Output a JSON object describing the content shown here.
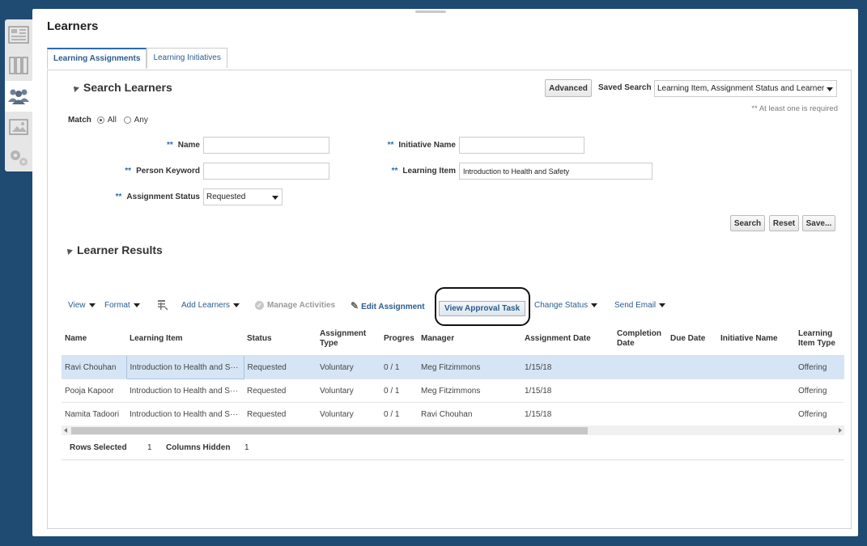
{
  "page": {
    "title": "Learners"
  },
  "tabs": [
    {
      "label": "Learning Assignments",
      "active": true
    },
    {
      "label": "Learning Initiatives",
      "active": false
    }
  ],
  "search": {
    "title": "Search Learners",
    "advanced_label": "Advanced",
    "saved_search_label": "Saved Search",
    "saved_search_value": "Learning Item, Assignment Status and Learner",
    "required_note": "** At least one is required",
    "match_label": "Match",
    "match_all": "All",
    "match_any": "Any",
    "required_marker": "**",
    "fields": {
      "name": {
        "label": "Name",
        "value": ""
      },
      "person_keyword": {
        "label": "Person Keyword",
        "value": ""
      },
      "assignment_status": {
        "label": "Assignment Status",
        "value": "Requested"
      },
      "initiative_name": {
        "label": "Initiative Name",
        "value": ""
      },
      "learning_item": {
        "label": "Learning Item",
        "value": "Introduction to Health and Safety"
      }
    },
    "buttons": {
      "search": "Search",
      "reset": "Reset",
      "save": "Save..."
    }
  },
  "results": {
    "title": "Learner Results",
    "toolbar": {
      "view": "View",
      "format": "Format",
      "add_learners": "Add Learners",
      "manage_activities": "Manage Activities",
      "edit_assignment": "Edit Assignment",
      "view_approval_task": "View Approval Task",
      "change_status": "Change Status",
      "send_email": "Send Email"
    },
    "columns": [
      "Name",
      "Learning Item",
      "Status",
      "Assignment Type",
      "Progres",
      "Manager",
      "Assignment Date",
      "Completion Date",
      "Due Date",
      "Initiative Name",
      "Learning Item Type"
    ],
    "rows": [
      [
        "Ravi Chouhan",
        "Introduction to Health and S···",
        "Requested",
        "Voluntary",
        "0 / 1",
        "Meg Fitzimmons",
        "1/15/18",
        "",
        "",
        "",
        "Offering"
      ],
      [
        "Pooja Kapoor",
        "Introduction to Health and S···",
        "Requested",
        "Voluntary",
        "0 / 1",
        "Meg Fitzimmons",
        "1/15/18",
        "",
        "",
        "",
        "Offering"
      ],
      [
        "Namita Tadoori",
        "Introduction to Health and S···",
        "Requested",
        "Voluntary",
        "0 / 1",
        "Ravi Chouhan",
        "1/15/18",
        "",
        "",
        "",
        "Offering"
      ]
    ],
    "footer": {
      "rows_selected_label": "Rows Selected",
      "rows_selected": "1",
      "columns_hidden_label": "Columns Hidden",
      "columns_hidden": "1"
    }
  },
  "icons": [
    "dashboard-icon",
    "library-icon",
    "learners-icon",
    "media-icon",
    "settings-icon"
  ],
  "colors": {
    "background": "#1f4a72",
    "accent": "#2b6cb0",
    "selected_row": "#d6e5f5"
  }
}
